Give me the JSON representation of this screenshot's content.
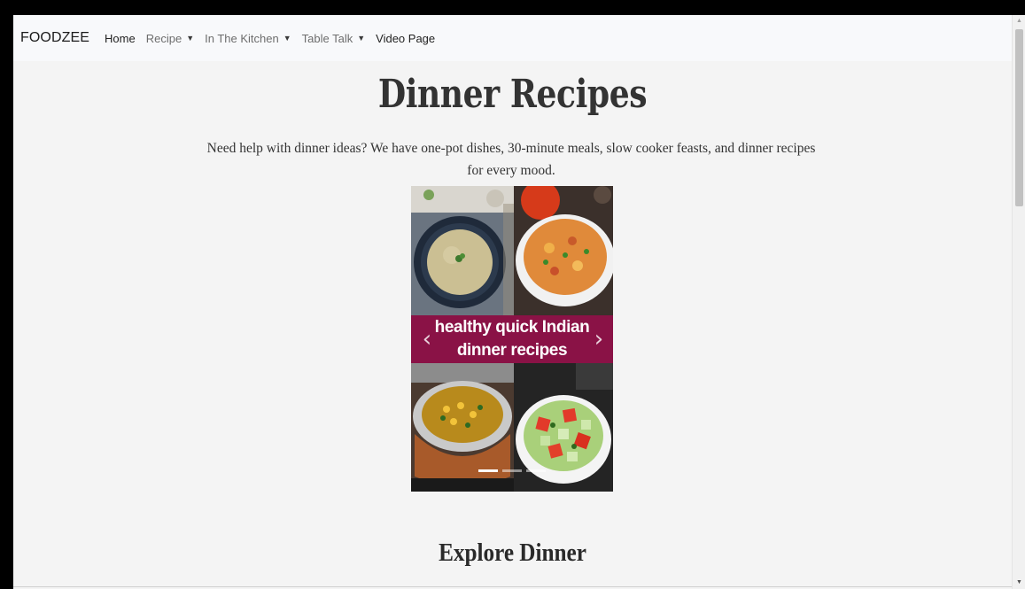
{
  "navbar": {
    "brand": "FOODZEE",
    "items": [
      {
        "label": "Home",
        "dropdown": false,
        "muted": false
      },
      {
        "label": "Recipe",
        "dropdown": true,
        "muted": true
      },
      {
        "label": "In The Kitchen",
        "dropdown": true,
        "muted": true
      },
      {
        "label": "Table Talk",
        "dropdown": true,
        "muted": true
      },
      {
        "label": "Video Page",
        "dropdown": false,
        "muted": false
      }
    ]
  },
  "hero": {
    "title": "Dinner Recipes",
    "lead": "Need help with dinner ideas? We have one-pot dishes, 30-minute meals, slow cooker feasts, and dinner recipes for every mood."
  },
  "carousel": {
    "banner_line1": "healthy quick Indian",
    "banner_line2": "dinner recipes",
    "prev_icon": "chevron-left-icon",
    "next_icon": "chevron-right-icon",
    "prev_glyph": "‹",
    "next_glyph": "›",
    "slide_count": 3,
    "active_slide": 1,
    "banner_color": "#8a1246"
  },
  "section": {
    "title": "Explore Dinner"
  }
}
